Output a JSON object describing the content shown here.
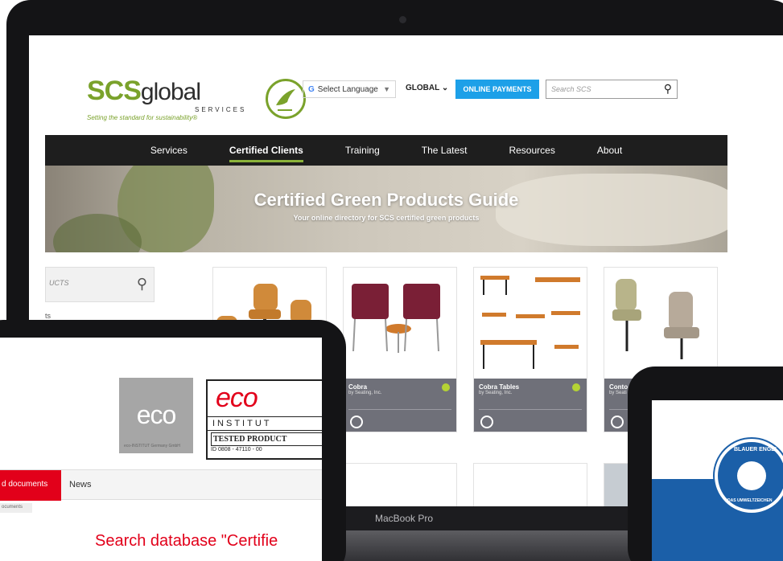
{
  "laptop": {
    "model_label": "MacBook Pro",
    "header": {
      "logo_word": "SCS",
      "logo_word_2": "global",
      "logo_services": "SERVICES",
      "logo_tagline": "Setting the standard for sustainability®",
      "language_label": "Select Language",
      "region_label": "GLOBAL",
      "payments_label": "ONLINE PAYMENTS",
      "search_placeholder": "Search SCS"
    },
    "nav": [
      "Services",
      "Certified Clients",
      "Training",
      "The Latest",
      "Resources",
      "About"
    ],
    "hero": {
      "title": "Certified Green Products Guide",
      "subtitle": "Your online directory for SCS certified green products"
    },
    "sidebar": {
      "search_placeholder": "UCTS",
      "text": "ts"
    },
    "products": [
      {
        "name": "",
        "brand": ""
      },
      {
        "name": "Cobra",
        "brand": "by Seating, Inc."
      },
      {
        "name": "Cobra Tables",
        "brand": "by Seating, Inc."
      },
      {
        "name": "Conto",
        "brand": "by Seati"
      }
    ]
  },
  "ipad_left": {
    "eco_logo_text": "eco",
    "eco_logo_caption": "eco-INSTITUT Germany GmbH",
    "institut_brand": "eco",
    "institut_label": "INSTITUT",
    "tested_label": "TESTED PRODUCT",
    "id_text": "ID 0808 - 47110 - 00",
    "tabs": {
      "documents": "d documents",
      "news": "News"
    },
    "breadcrumb": "ocuments",
    "search_heading": "Search database \"Certifie"
  },
  "ipad_right": {
    "badge_top": "BLAUER ENGEL",
    "badge_bottom": "DAS UMWELTZEICHEN"
  },
  "colors": {
    "scs_green": "#7aa22b",
    "nav_bg": "#1e1e1e",
    "payment_blue": "#1da0e8",
    "eco_red": "#e2001a",
    "angel_blue": "#1b5fa8"
  }
}
